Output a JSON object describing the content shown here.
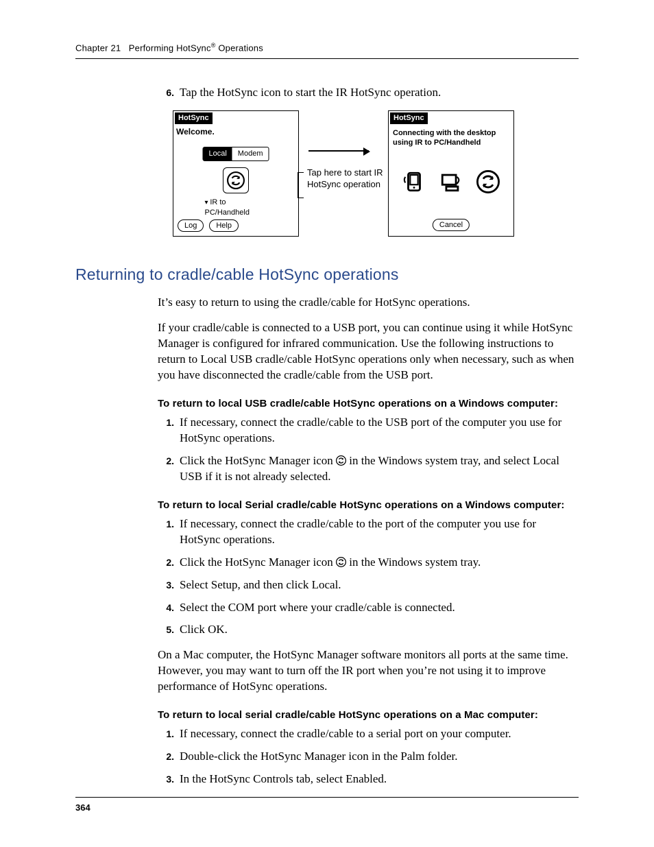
{
  "header": {
    "chapter_label": "Chapter 21",
    "chapter_title_prefix": "Performing HotSync",
    "chapter_title_suffix": " Operations",
    "reg_mark": "®"
  },
  "intro_step": {
    "num": "6.",
    "text": "Tap the HotSync icon to start the IR HotSync operation."
  },
  "figure": {
    "left": {
      "title": "HotSync",
      "welcome": "Welcome.",
      "seg_local": "Local",
      "seg_modem": "Modem",
      "ir_label": "IR to PC/Handheld",
      "btn_log": "Log",
      "btn_help": "Help"
    },
    "mid": {
      "caption": "Tap here to start IR HotSync operation"
    },
    "right": {
      "title": "HotSync",
      "connecting": "Connecting with the desktop using IR to PC/Handheld",
      "btn_cancel": "Cancel"
    }
  },
  "section_title": "Returning to cradle/cable HotSync operations",
  "p1": "It’s easy to return to using the cradle/cable for HotSync operations.",
  "p2": "If your cradle/cable is connected to a USB port, you can continue using it while HotSync Manager is configured for infrared communication. Use the following instructions to return to Local USB cradle/cable HotSync operations only when necessary, such as when you have disconnected the cradle/cable from the USB port.",
  "sub1": "To return to local USB cradle/cable HotSync operations on a Windows computer:",
  "list1": [
    {
      "n": "1.",
      "t": "If necessary, connect the cradle/cable to the USB port of the computer you use for HotSync operations."
    },
    {
      "n": "2.",
      "pre": "Click the HotSync Manager icon ",
      "post": " in the Windows system tray, and select Local USB if it is not already selected."
    }
  ],
  "sub2": "To return to local Serial cradle/cable HotSync operations on a Windows computer:",
  "list2": [
    {
      "n": "1.",
      "t": "If necessary, connect the cradle/cable to the port of the computer you use for HotSync operations."
    },
    {
      "n": "2.",
      "pre": "Click the HotSync Manager icon ",
      "post": " in the Windows system tray."
    },
    {
      "n": "3.",
      "t": "Select Setup, and then click Local."
    },
    {
      "n": "4.",
      "t": "Select the COM port where your cradle/cable is connected."
    },
    {
      "n": "5.",
      "t": "Click OK."
    }
  ],
  "p3": "On a Mac computer, the HotSync Manager software monitors all ports at the same time. However, you may want to turn off the IR port when you’re not using it to improve performance of HotSync operations.",
  "sub3": "To return to local serial cradle/cable HotSync operations on a Mac computer:",
  "list3": [
    {
      "n": "1.",
      "t": "If necessary, connect the cradle/cable to a serial port on your computer."
    },
    {
      "n": "2.",
      "t": "Double-click the HotSync Manager icon in the Palm folder."
    },
    {
      "n": "3.",
      "t": "In the HotSync Controls tab, select Enabled."
    }
  ],
  "page_number": "364"
}
